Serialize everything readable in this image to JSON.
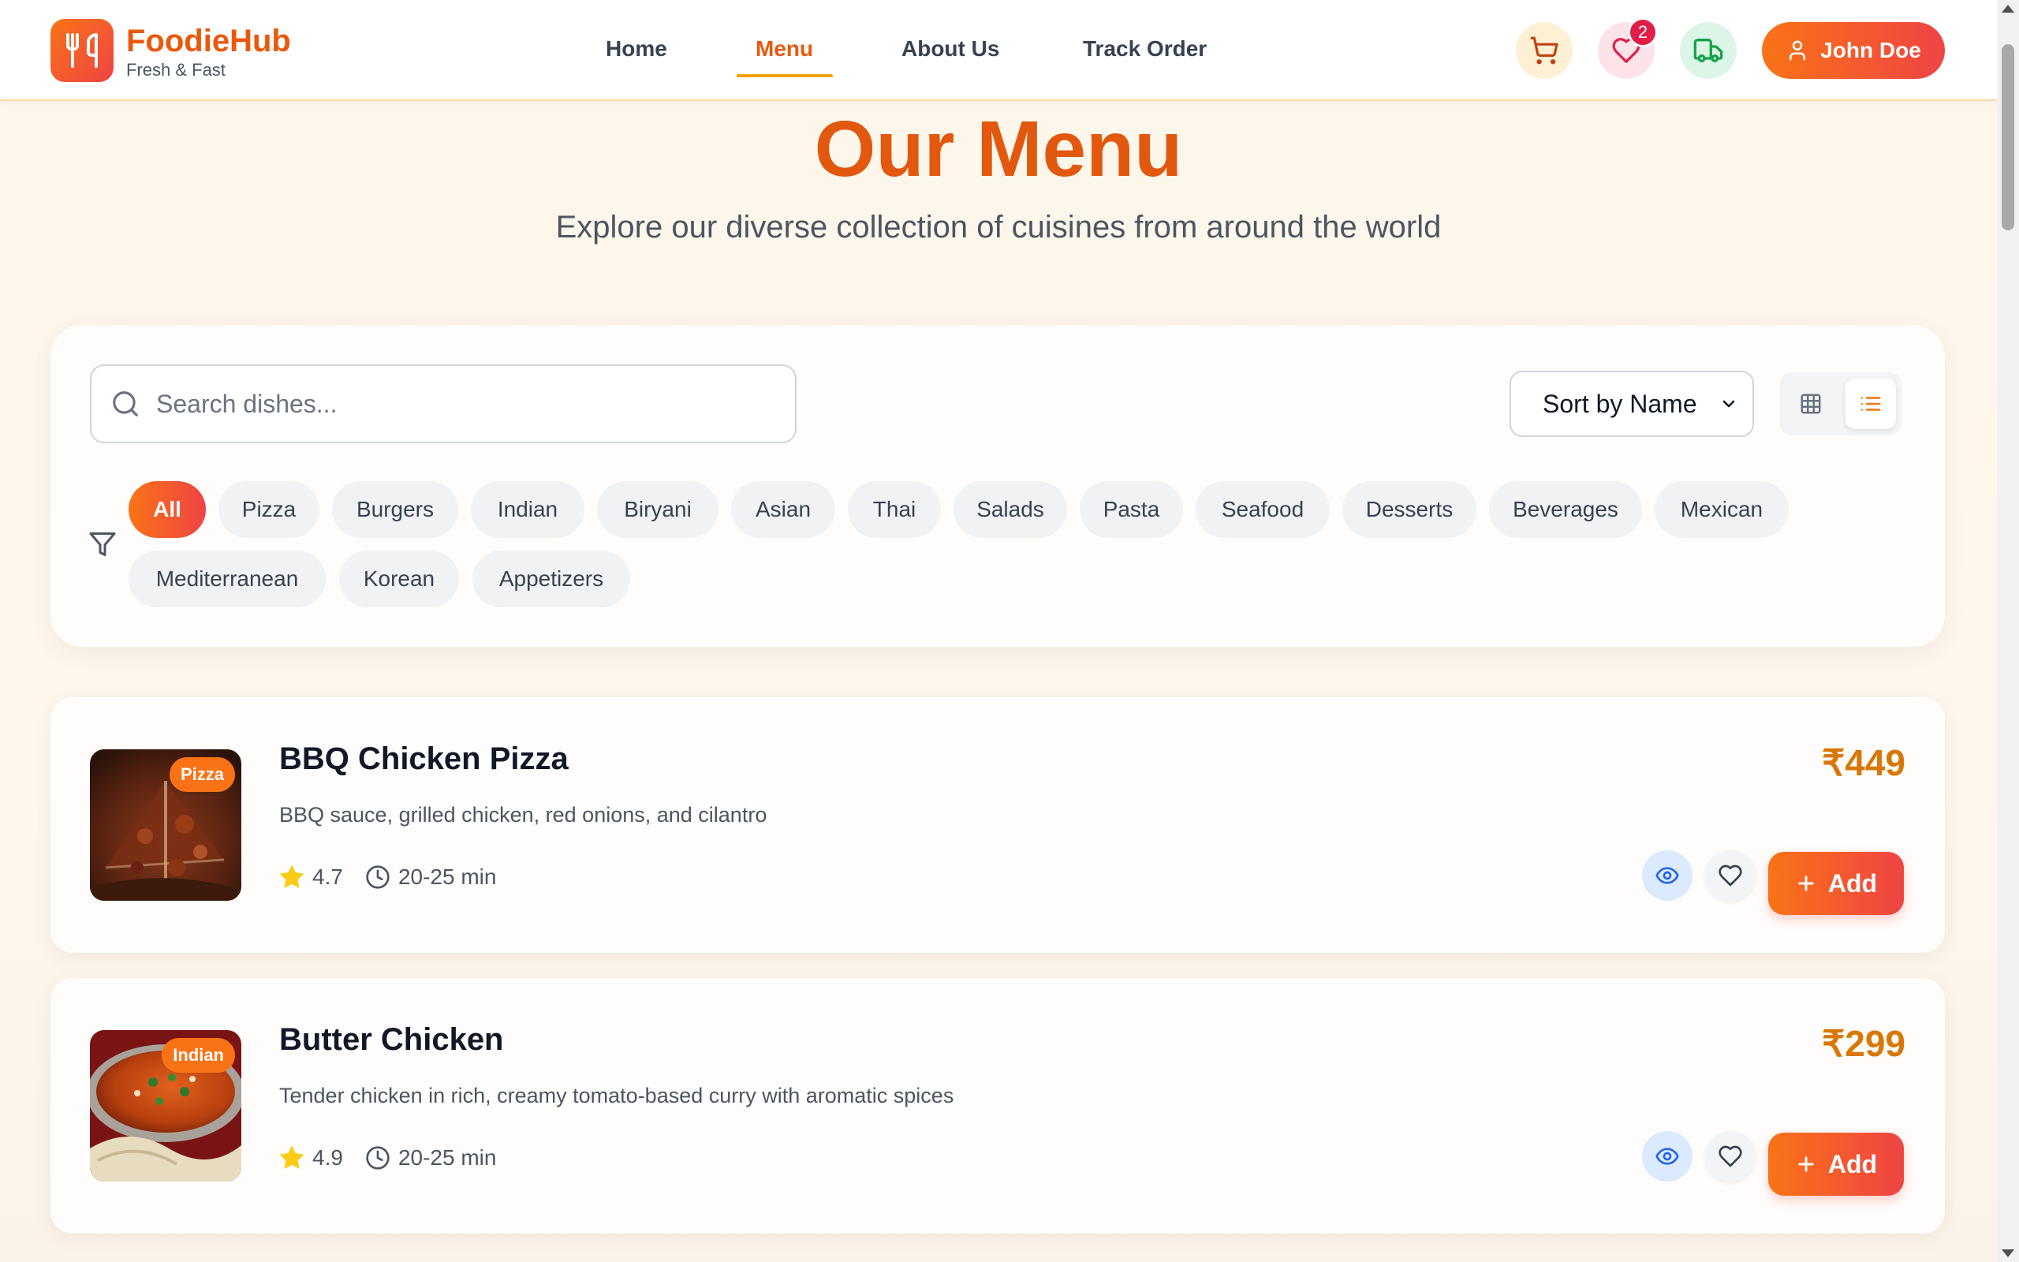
{
  "brand": {
    "name": "FoodieHub",
    "tagline": "Fresh & Fast",
    "icon": "utensils-icon"
  },
  "nav": {
    "items": [
      {
        "label": "Home",
        "active": false
      },
      {
        "label": "Menu",
        "active": true
      },
      {
        "label": "About Us",
        "active": false
      },
      {
        "label": "Track Order",
        "active": false
      }
    ]
  },
  "header_actions": {
    "cart_icon": "cart-icon",
    "favorites_icon": "heart-icon",
    "favorites_count": "2",
    "track_icon": "truck-icon",
    "user_label": "John Doe"
  },
  "hero": {
    "title": "Our Menu",
    "subtitle": "Explore our diverse collection of cuisines from around the world"
  },
  "search": {
    "placeholder": "Search dishes...",
    "value": ""
  },
  "sort": {
    "selected": "Sort by Name"
  },
  "view_mode": "list",
  "categories": [
    "All",
    "Pizza",
    "Burgers",
    "Indian",
    "Biryani",
    "Asian",
    "Thai",
    "Salads",
    "Pasta",
    "Seafood",
    "Desserts",
    "Beverages",
    "Mexican",
    "Mediterranean",
    "Korean",
    "Appetizers"
  ],
  "active_category": "All",
  "dishes": [
    {
      "name": "BBQ Chicken Pizza",
      "category": "Pizza",
      "description": "BBQ sauce, grilled chicken, red onions, and cilantro",
      "rating": "4.7",
      "time": "20-25 min",
      "price": "₹449",
      "add_label": "Add"
    },
    {
      "name": "Butter Chicken",
      "category": "Indian",
      "description": "Tender chicken in rich, creamy tomato-based curry with aromatic spices",
      "rating": "4.9",
      "time": "20-25 min",
      "price": "₹299",
      "add_label": "Add"
    }
  ],
  "colors": {
    "primary": "#f97316",
    "accent_red": "#ef4444",
    "title": "#e2580f",
    "price": "#d97706",
    "badge": "#e11d48"
  }
}
